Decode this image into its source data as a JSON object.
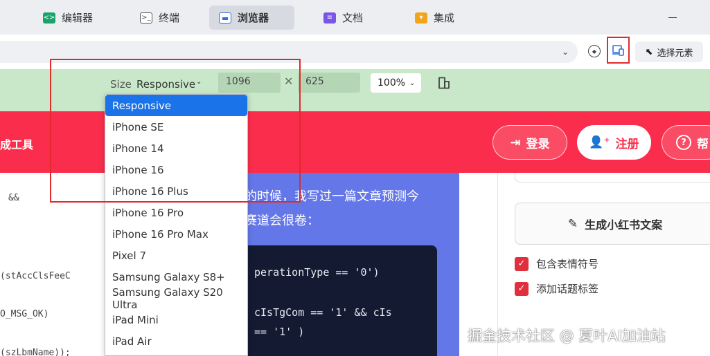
{
  "tabs": [
    {
      "label": "编辑器",
      "icon": "code-editor-icon",
      "color": "#1aa36b"
    },
    {
      "label": "终端",
      "icon": "terminal-icon",
      "color": "#555555"
    },
    {
      "label": "浏览器",
      "icon": "browser-window-icon",
      "color": "#2f6fdf",
      "active": true
    },
    {
      "label": "文档",
      "icon": "document-icon",
      "color": "#7a55e8"
    },
    {
      "label": "集成",
      "icon": "integration-icon",
      "color": "#f2a51a"
    }
  ],
  "toolbar": {
    "pick_element_label": "选择元素"
  },
  "responsive": {
    "size_label": "Size",
    "size_value": "Responsive",
    "width": "1096",
    "height": "625",
    "times": "✕",
    "zoom": "100%"
  },
  "device_options": [
    "Responsive",
    "iPhone SE",
    "iPhone 14",
    "iPhone 16",
    "iPhone 16 Plus",
    "iPhone 16 Pro",
    "iPhone 16 Pro Max",
    "Pixel 7",
    "Samsung Galaxy S8+",
    "Samsung Galaxy S20 Ultra",
    "iPad Mini",
    "iPad Air"
  ],
  "site": {
    "brand": "成工具",
    "login": "登录",
    "signup": "注册",
    "help": "帮"
  },
  "left_code": [
    "&&",
    "(stAccClsFeeC",
    "O_MSG_OK)",
    "(szLbmName));"
  ],
  "article": {
    "line1": "的时候，我写过一篇文章预测今",
    "line2": "赛道会很卷：",
    "code": [
      "perationType == '0')",
      "cIsTgCom == '1' && cIs",
      "== '1' )"
    ]
  },
  "right_panel": {
    "generate_button": "生成小红书文案",
    "checkbox_emoji": "包含表情符号",
    "checkbox_tags": "添加话题标签"
  },
  "watermark": "掘金技术社区 @ 夏叶AI加油站",
  "colors": {
    "header_red": "#fb2d4c",
    "toolbar_green": "#c9e8c9",
    "selected_blue": "#1a73e8",
    "article_blue": "#6477e8"
  }
}
